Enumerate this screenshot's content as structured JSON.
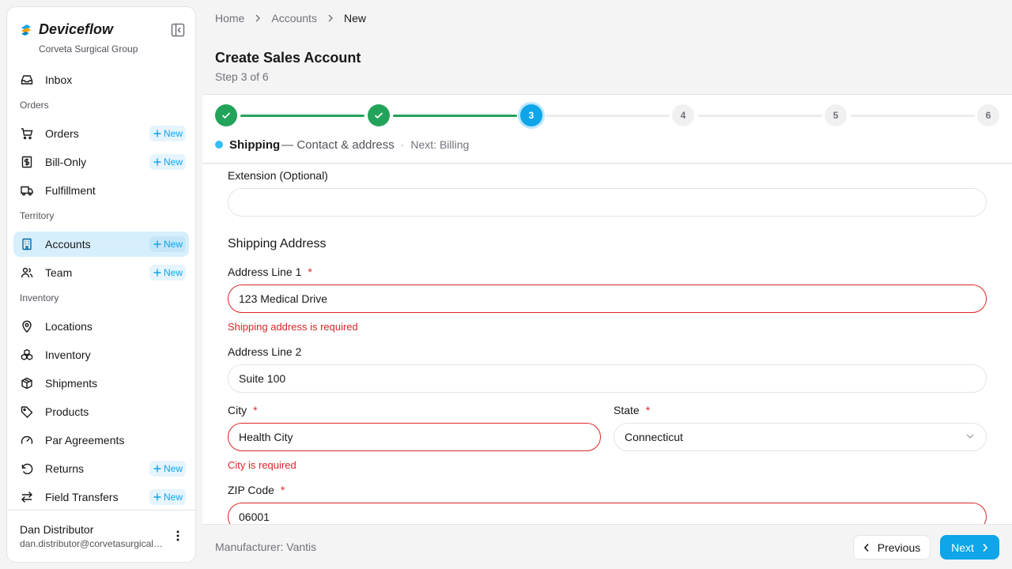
{
  "brand": {
    "name": "Deviceflow",
    "org": "Corveta Surgical Group"
  },
  "sidebar": {
    "items": [
      {
        "label": "Inbox",
        "icon": "inbox-icon"
      },
      {
        "section": "Orders"
      },
      {
        "label": "Orders",
        "icon": "cart-icon",
        "new": "New"
      },
      {
        "label": "Bill-Only",
        "icon": "receipt-dollar-icon",
        "new": "New"
      },
      {
        "label": "Fulfillment",
        "icon": "truck-icon"
      },
      {
        "section": "Territory"
      },
      {
        "label": "Accounts",
        "icon": "building-icon",
        "new": "New",
        "active": true
      },
      {
        "label": "Team",
        "icon": "users-icon",
        "new": "New"
      },
      {
        "section": "Inventory"
      },
      {
        "label": "Locations",
        "icon": "map-pin-icon"
      },
      {
        "label": "Inventory",
        "icon": "boxes-icon"
      },
      {
        "label": "Shipments",
        "icon": "package-icon"
      },
      {
        "label": "Products",
        "icon": "tag-icon"
      },
      {
        "label": "Par Agreements",
        "icon": "gauge-icon"
      },
      {
        "label": "Returns",
        "icon": "undo-icon",
        "new": "New"
      },
      {
        "label": "Field Transfers",
        "icon": "arrows-transfer-icon",
        "new": "New"
      }
    ]
  },
  "user": {
    "name": "Dan Distributor",
    "email": "dan.distributor@corvetasurgical.com"
  },
  "breadcrumb": {
    "home": "Home",
    "accounts": "Accounts",
    "current": "New"
  },
  "page": {
    "title": "Create Sales Account",
    "subtitle": "Step 3 of 6"
  },
  "stepper": {
    "steps": [
      "1",
      "2",
      "3",
      "4",
      "5",
      "6"
    ],
    "current_step": 3,
    "current_name": "Shipping",
    "current_desc": "— Contact & address",
    "separator": "·",
    "next": "Next: Billing"
  },
  "form": {
    "extension": {
      "label": "Extension (Optional)",
      "value": ""
    },
    "shipping_section": "Shipping Address",
    "address1": {
      "label": "Address Line 1",
      "required": "*",
      "value": "123 Medical Drive",
      "error": "Shipping address is required"
    },
    "address2": {
      "label": "Address Line 2",
      "value": "Suite 100"
    },
    "city": {
      "label": "City",
      "required": "*",
      "value": "Health City",
      "error": "City is required"
    },
    "state": {
      "label": "State",
      "required": "*",
      "value": "Connecticut"
    },
    "zip": {
      "label": "ZIP Code",
      "required": "*",
      "value": "06001"
    }
  },
  "footer": {
    "manufacturer_label": "Manufacturer:",
    "manufacturer_value": "Vantis",
    "previous": "Previous",
    "next": "Next"
  },
  "colors": {
    "accent": "#0ea5e9",
    "success": "#22a35a",
    "error": "#dc2626"
  }
}
